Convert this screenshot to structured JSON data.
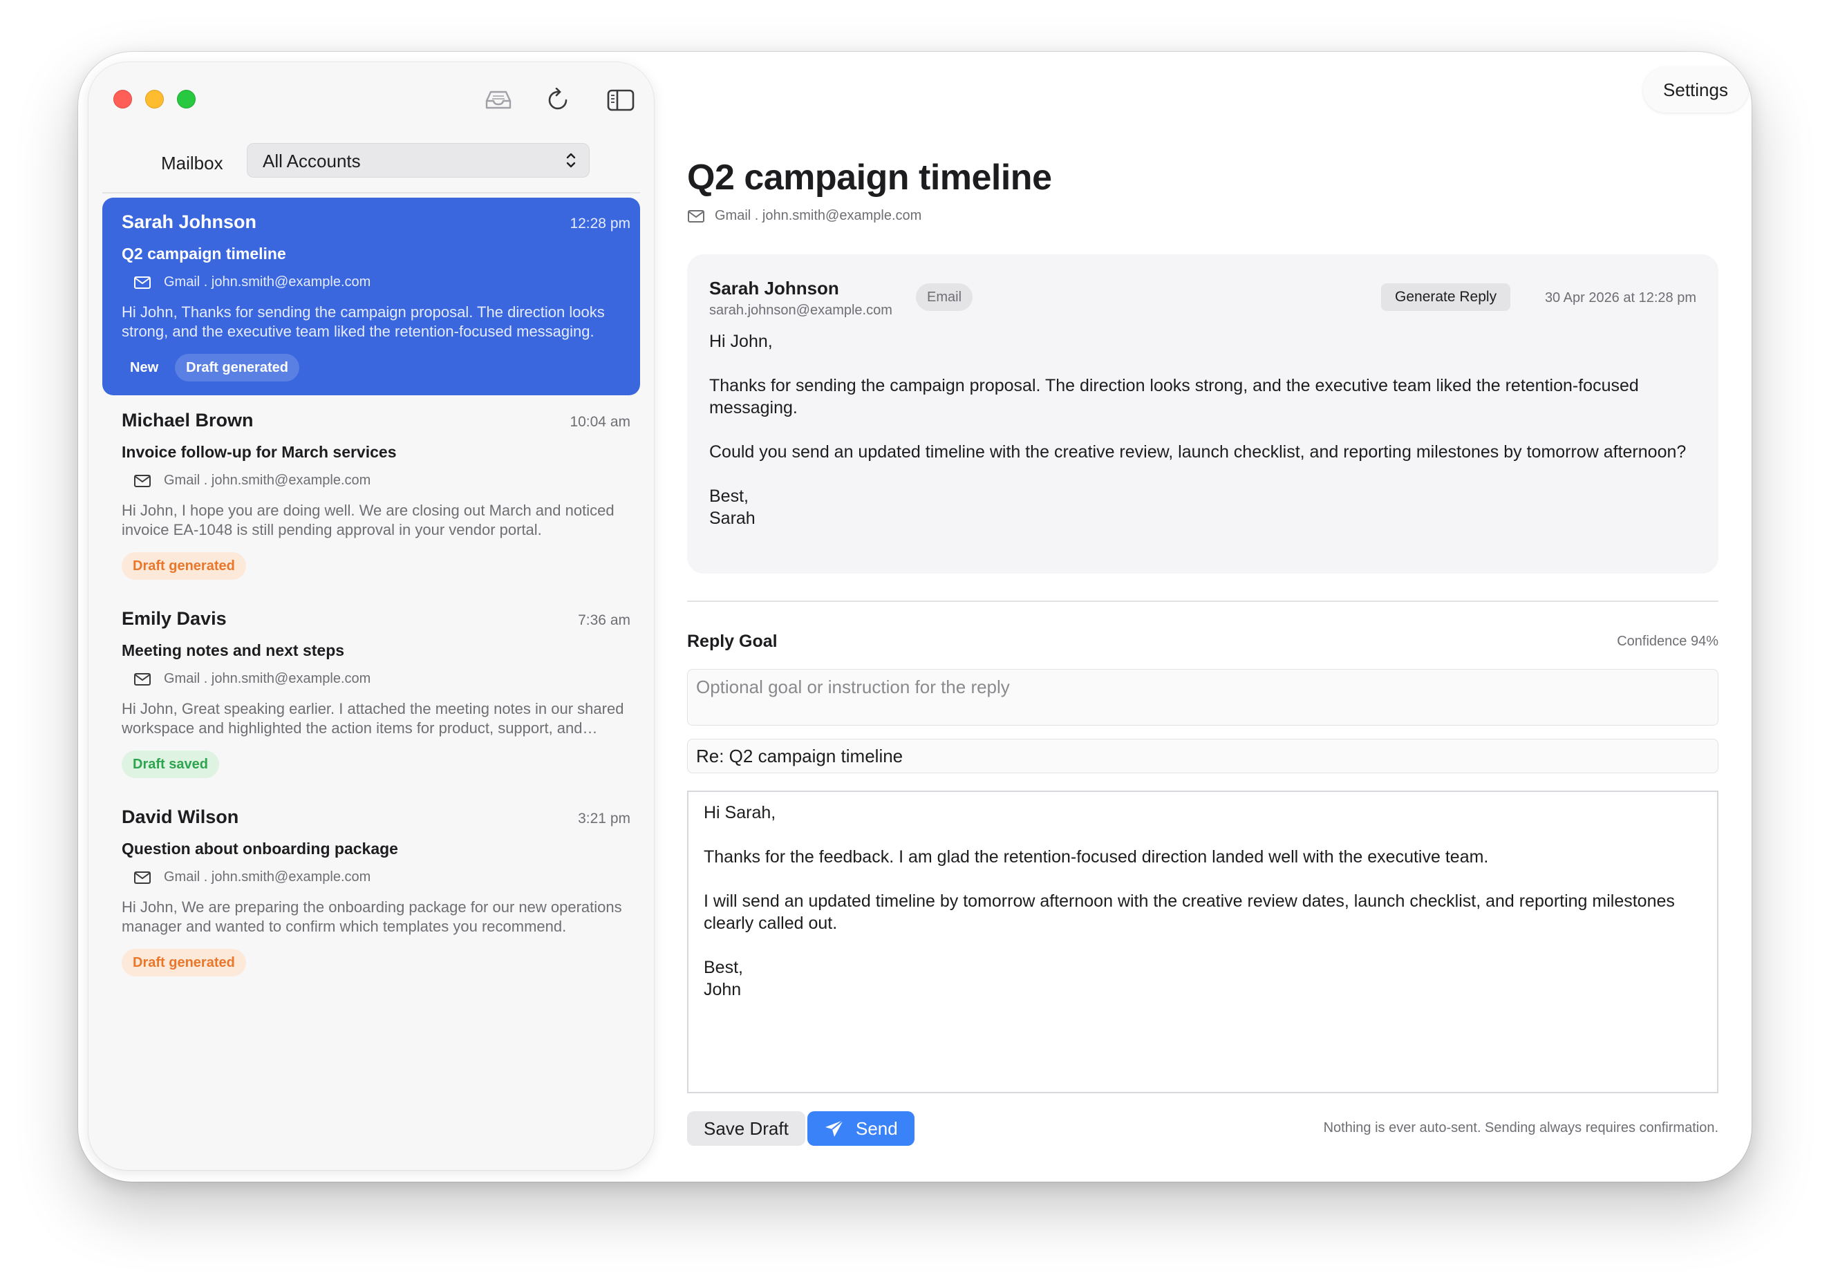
{
  "sidebar": {
    "mailbox_label": "Mailbox",
    "mailbox_selected": "All Accounts",
    "toolbar_icons": [
      "inbox-icon",
      "refresh-icon",
      "sidebar-toggle-icon"
    ],
    "items": [
      {
        "sender": "Sarah Johnson",
        "time": "12:28 pm",
        "subject": "Q2 campaign timeline",
        "account": "Gmail . john.smith@example.com",
        "preview": "Hi John,  Thanks for sending the campaign proposal. The direction looks strong, and the executive team liked the retention-focused messaging.",
        "badges": [
          "New",
          "Draft generated"
        ],
        "selected": true
      },
      {
        "sender": "Michael Brown",
        "time": "10:04 am",
        "subject": "Invoice follow-up for March services",
        "account": "Gmail . john.smith@example.com",
        "preview": "Hi John,  I hope you are doing well. We are closing out March and noticed invoice EA-1048 is still pending approval in your vendor portal.",
        "badges": [
          "Draft generated"
        ]
      },
      {
        "sender": "Emily Davis",
        "time": "7:36 am",
        "subject": "Meeting notes and next steps",
        "account": "Gmail . john.smith@example.com",
        "preview": "Hi John,  Great speaking earlier. I attached the meeting notes in our shared workspace and highlighted the action items for product, support, and marketing.",
        "badges": [
          "Draft saved"
        ]
      },
      {
        "sender": "David Wilson",
        "time": "3:21 pm",
        "subject": "Question about onboarding package",
        "account": "Gmail . john.smith@example.com",
        "preview": "Hi John,  We are preparing the onboarding package for our new operations manager and wanted to confirm which templates you recommend.",
        "badges": [
          "Draft generated"
        ]
      }
    ]
  },
  "header": {
    "settings_label": "Settings"
  },
  "message": {
    "title": "Q2 campaign timeline",
    "account": "Gmail . john.smith@example.com",
    "sender": "Sarah Johnson",
    "sender_email": "sarah.johnson@example.com",
    "type_badge": "Email",
    "generate_reply_label": "Generate Reply",
    "date": "30 Apr 2026 at 12:28 pm",
    "body": [
      "Hi John,",
      "Thanks for sending the campaign proposal. The direction looks strong, and the executive team liked the retention-focused messaging.",
      "Could you send an updated timeline with the creative review, launch checklist, and reporting milestones by tomorrow afternoon?",
      "Best,\nSarah"
    ]
  },
  "reply": {
    "goal_label": "Reply Goal",
    "confidence": "Confidence 94%",
    "goal_placeholder": "Optional goal or instruction for the reply",
    "goal_value": "",
    "subject_value": "Re: Q2 campaign timeline",
    "body": [
      "Hi Sarah,",
      "Thanks for the feedback. I am glad the retention-focused direction landed well with the executive team.",
      "I will send an updated timeline by tomorrow afternoon with the creative review dates, launch checklist, and reporting milestones clearly called out.",
      "Best,\nJohn"
    ],
    "save_draft_label": "Save Draft",
    "send_label": "Send",
    "footnote": "Nothing is ever auto-sent. Sending always requires confirmation."
  },
  "colors": {
    "accent": "#3a66de",
    "send_button": "#3a82f7",
    "badge_orange": "#e9772b",
    "badge_green": "#2da44e"
  }
}
